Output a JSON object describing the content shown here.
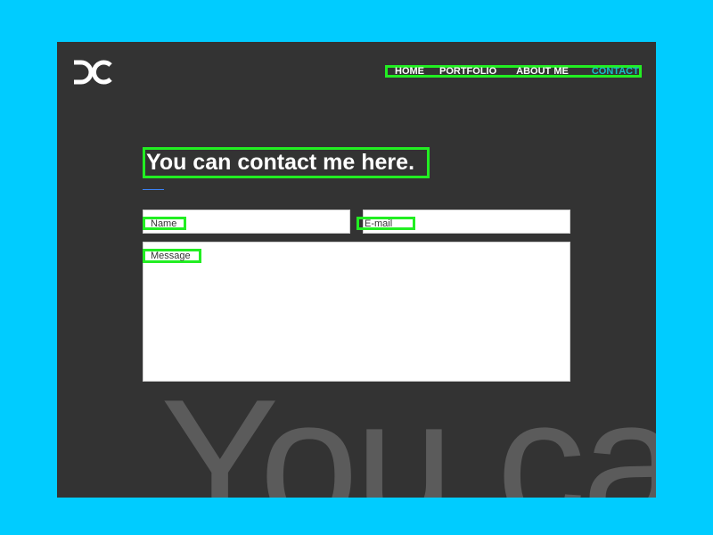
{
  "logo": {
    "text": "DC",
    "icon": "dc-logo-icon",
    "color": "#ffffff"
  },
  "nav": {
    "items": [
      {
        "label": "HOME",
        "active": false
      },
      {
        "label": "PORTFOLIO",
        "active": false
      },
      {
        "label": "ABOUT ME",
        "active": false
      },
      {
        "label": "CONTACT",
        "active": true
      }
    ],
    "active_color": "#15C0C8"
  },
  "contact": {
    "heading": "You can contact me here.",
    "underline_color": "#3b82f6",
    "form": {
      "name_placeholder": "Name",
      "email_placeholder": "E-mail",
      "message_placeholder": "Message"
    }
  },
  "background_text": "You ca",
  "colors": {
    "page_background": "#00CCFF",
    "panel_background": "#333333",
    "highlight": "#22EE22"
  }
}
